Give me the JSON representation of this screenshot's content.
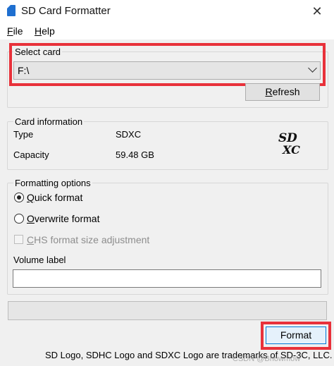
{
  "window": {
    "title": "SD Card Formatter",
    "close_glyph": "✕",
    "accent_color": "#e8313a"
  },
  "menu": {
    "file": {
      "mnemonic": "F",
      "rest": "ile"
    },
    "help": {
      "mnemonic": "H",
      "rest": "elp"
    }
  },
  "select_card": {
    "label": "Select card",
    "value": "F:\\",
    "refresh": {
      "mnemonic": "R",
      "rest": "efresh"
    }
  },
  "card_info": {
    "label": "Card information",
    "type_label": "Type",
    "type_value": "SDXC",
    "capacity_label": "Capacity",
    "capacity_value": "59.48 GB",
    "logo": {
      "top": "S",
      "mid": "D",
      "bottom": "XC"
    }
  },
  "format_options": {
    "label": "Formatting options",
    "quick": {
      "mnemonic": "Q",
      "rest": "uick format",
      "checked": true
    },
    "overwrite": {
      "mnemonic": "O",
      "rest": "verwrite format",
      "checked": false
    },
    "chs": {
      "mnemonic": "C",
      "rest": "HS format size adjustment",
      "enabled": false
    },
    "volume_label": "Volume label",
    "volume_value": ""
  },
  "progress": {
    "value": 0
  },
  "format_button": "Format",
  "footer": "SD Logo, SDHC Logo and SDXC Logo are trademarks of SD-3C, LLC.",
  "watermark": "CSDN @Bhowmow"
}
